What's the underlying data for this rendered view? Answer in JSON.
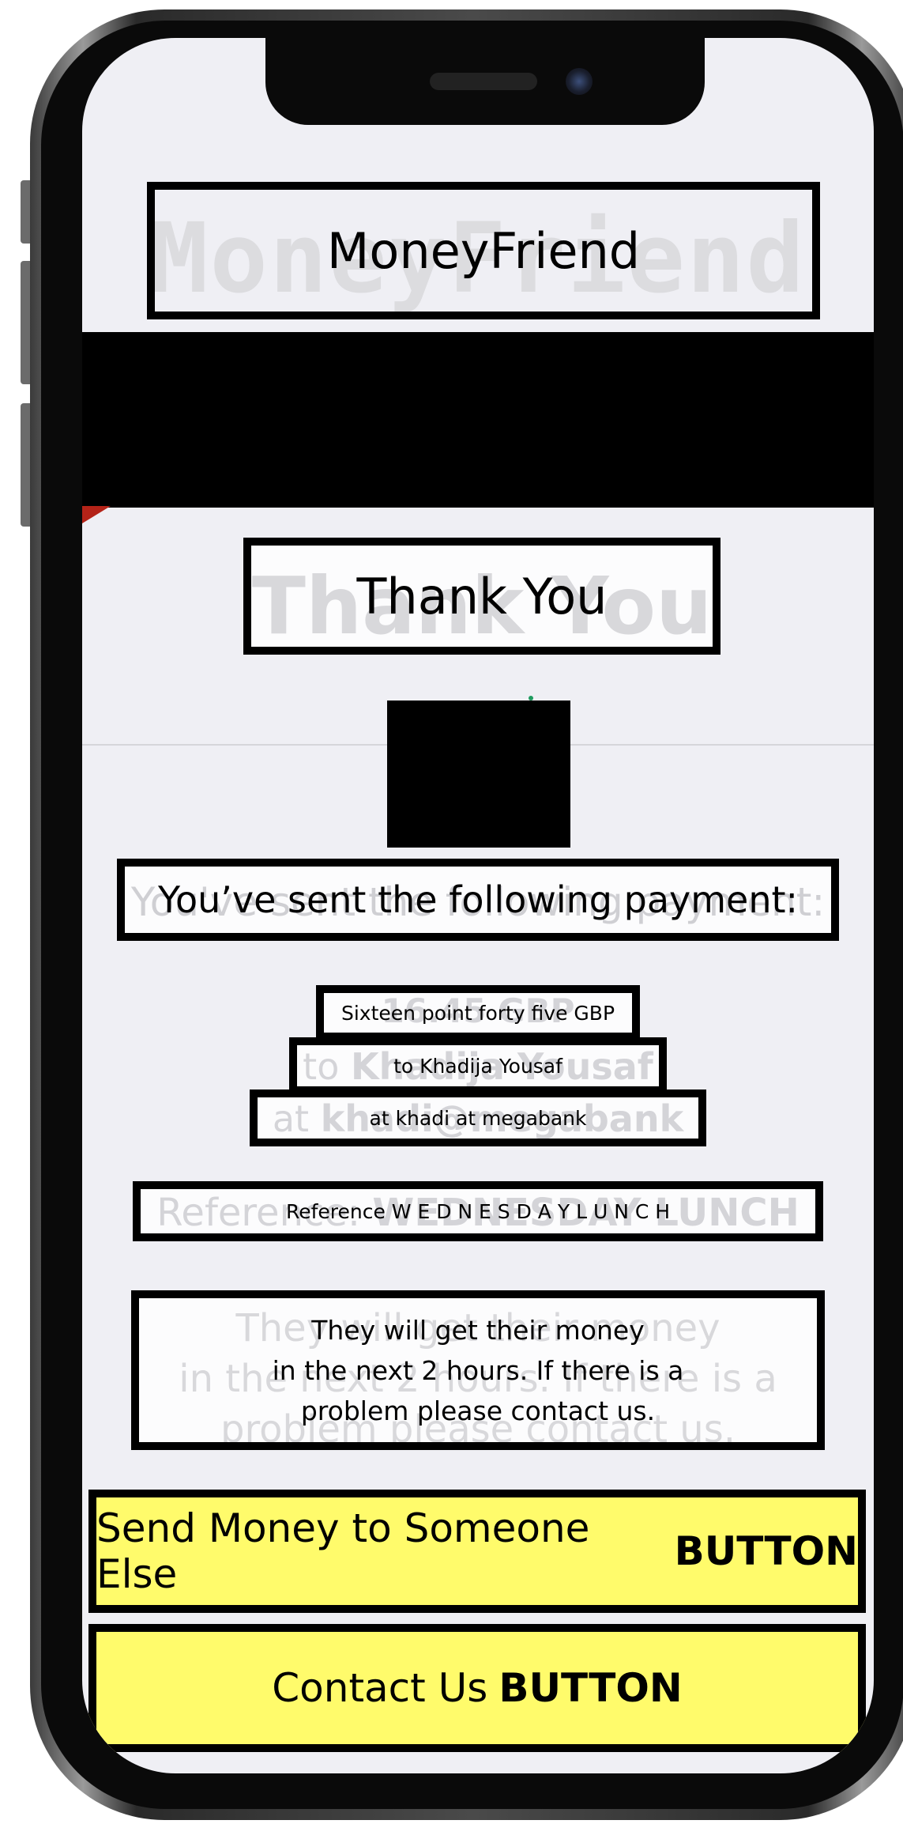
{
  "app": {
    "header_ghost": "MoneyFriend",
    "header_label": "MoneyFriend"
  },
  "confirmation": {
    "title_ghost": "Thank You",
    "title_label": "Thank You",
    "sent_ghost": "You've sent the following payment:",
    "sent_label": "You’ve sent the following payment:"
  },
  "payment": {
    "amount_ghost": "16.45 GBP",
    "amount_label": "Sixteen point forty five GBP",
    "recipient_ghost_prefix": "to",
    "recipient_ghost_name": "Khadija Yousaf",
    "recipient_label": "to Khadija Yousaf",
    "email_ghost_prefix": "at",
    "email_ghost_value": "khadi@megabank",
    "email_label": "at khadi at megabank",
    "reference_ghost_prefix": "Reference:",
    "reference_ghost_value": "WEDNESDAY LUNCH",
    "reference_label": "Reference W E D N E S D A Y L U N C H"
  },
  "notice": {
    "ghost_line1": "They will get their money",
    "ghost_line2": "in the next 2 hours. If there is a",
    "ghost_line3": "problem please contact us.",
    "label_line1": "They will get their money",
    "label_line2": "in the next 2 hours. If there is a",
    "label_line3": "problem please contact us."
  },
  "actions": {
    "send_again_label": "Send Money to Someone Else",
    "send_again_tag": "BUTTON",
    "contact_label": "Contact Us",
    "contact_tag": "BUTTON"
  },
  "colors": {
    "button_fill": "#fffb6b",
    "screen_background": "#efeff4",
    "ghost_text": "#cfcfd3"
  }
}
